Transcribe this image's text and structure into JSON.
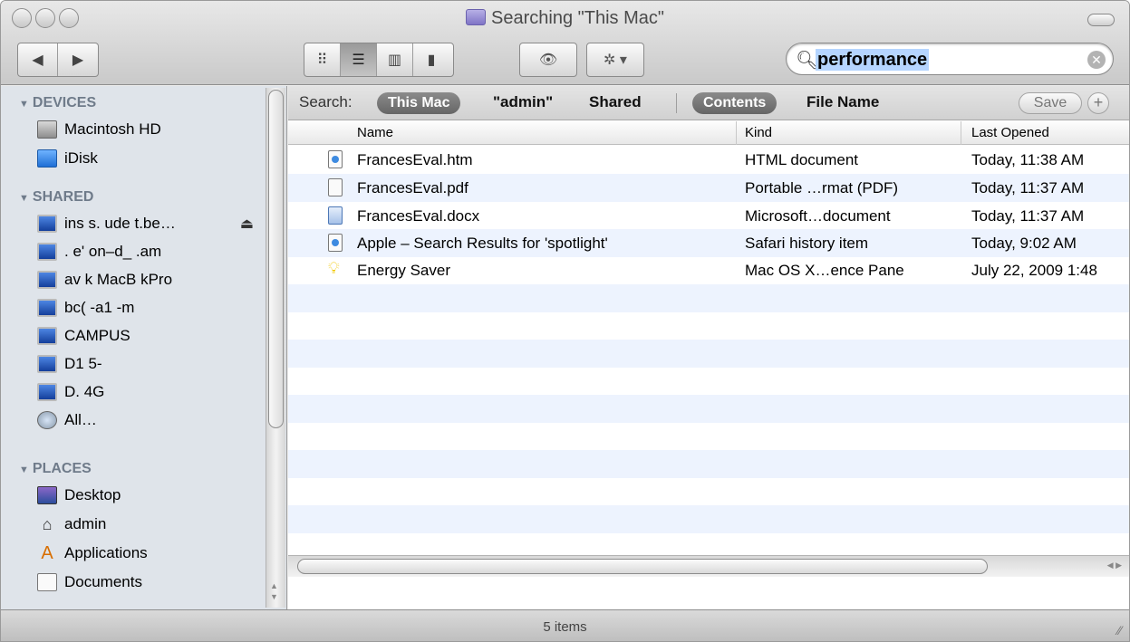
{
  "window": {
    "title": "Searching \"This Mac\""
  },
  "toolbar": {
    "back_label": "◀",
    "forward_label": "▶",
    "view_icons": [
      "icon-view-icon",
      "list-view-icon",
      "column-view-icon",
      "coverflow-view-icon"
    ],
    "quicklook_label": "👁",
    "action_label": "✲ ▾",
    "search_value": "performance"
  },
  "sidebar": {
    "devices_header": "DEVICES",
    "devices": [
      {
        "label": "Macintosh HD",
        "icon": "hard-disk-icon"
      },
      {
        "label": "iDisk",
        "icon": "idisk-icon"
      }
    ],
    "shared_header": "SHARED",
    "shared": [
      {
        "label": "ins   s.  ude  t.be…",
        "icon": "computer-icon"
      },
      {
        "label": ".  e'  on–d_  .am",
        "icon": "computer-icon"
      },
      {
        "label": "av      k  MacB   kPro",
        "icon": "computer-icon"
      },
      {
        "label": "bc(    -a1   -m",
        "icon": "computer-icon"
      },
      {
        "label": "CAMPUS",
        "icon": "computer-icon"
      },
      {
        "label": "D1     5-",
        "icon": "computer-icon"
      },
      {
        "label": "D.   4G",
        "icon": "computer-icon"
      },
      {
        "label": "All…",
        "icon": "network-globe-icon"
      }
    ],
    "places_header": "PLACES",
    "places": [
      {
        "label": "Desktop",
        "icon": "desktop-icon"
      },
      {
        "label": "admin",
        "icon": "home-icon"
      },
      {
        "label": "Applications",
        "icon": "applications-icon"
      },
      {
        "label": "Documents",
        "icon": "documents-icon"
      }
    ]
  },
  "scopebar": {
    "search_label": "Search:",
    "this_mac": "This Mac",
    "admin": "\"admin\"",
    "shared": "Shared",
    "contents": "Contents",
    "file_name": "File Name",
    "save": "Save",
    "plus": "+"
  },
  "columns": {
    "name": "Name",
    "kind": "Kind",
    "last_opened": "Last Opened"
  },
  "results": [
    {
      "name": "FrancesEval.htm",
      "kind": "HTML document",
      "last_opened": "Today, 11:38 AM",
      "icon": "html-file-icon"
    },
    {
      "name": "FrancesEval.pdf",
      "kind": "Portable …rmat (PDF)",
      "last_opened": "Today, 11:37 AM",
      "icon": "pdf-file-icon"
    },
    {
      "name": "FrancesEval.docx",
      "kind": "Microsoft…document",
      "last_opened": "Today, 11:37 AM",
      "icon": "word-file-icon"
    },
    {
      "name": "Apple – Search Results for 'spotlight'",
      "kind": "Safari history item",
      "last_opened": "Today, 9:02 AM",
      "icon": "safari-history-icon"
    },
    {
      "name": "Energy Saver",
      "kind": "Mac OS X…ence Pane",
      "last_opened": "July 22, 2009 1:48",
      "icon": "lightbulb-icon"
    }
  ],
  "status": {
    "items": "5 items"
  },
  "colors": {
    "stripe": "#edf3fe",
    "sidebar_bg": "#dfe4ea",
    "selection": "#b5d5ff"
  }
}
